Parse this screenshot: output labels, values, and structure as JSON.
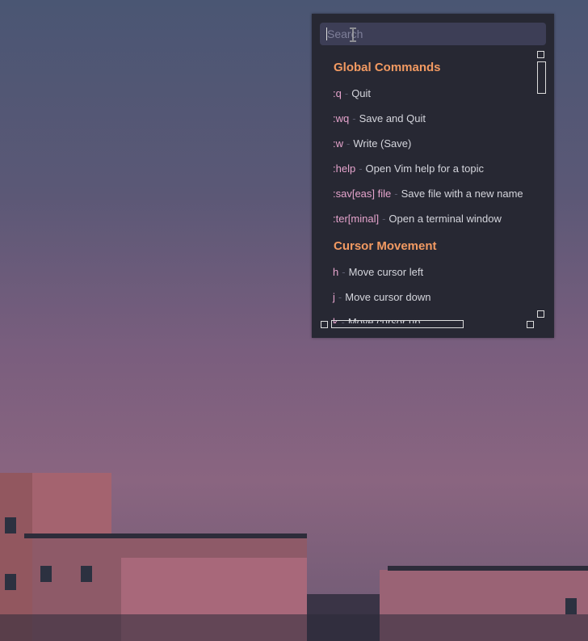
{
  "search": {
    "placeholder": "Search"
  },
  "sections": [
    {
      "title": "Global Commands",
      "items": [
        {
          "key": ":q",
          "desc": "Quit"
        },
        {
          "key": ":wq",
          "desc": "Save and Quit"
        },
        {
          "key": ":w",
          "desc": "Write (Save)"
        },
        {
          "key": ":help",
          "desc": "Open Vim help for a topic"
        },
        {
          "key": ":sav[eas] file",
          "desc": "Save file with a new name"
        },
        {
          "key": ":ter[minal]",
          "desc": "Open a terminal window"
        }
      ]
    },
    {
      "title": "Cursor Movement",
      "items": [
        {
          "key": "h",
          "desc": "Move cursor left"
        },
        {
          "key": "j",
          "desc": "Move cursor down"
        },
        {
          "key": "k",
          "desc": "Move cursor up"
        }
      ]
    }
  ],
  "separator": "-",
  "colors": {
    "heading": "#f29a62",
    "key": "#e6a4cd",
    "desc": "#d4d5dc",
    "panel": "#272833"
  }
}
